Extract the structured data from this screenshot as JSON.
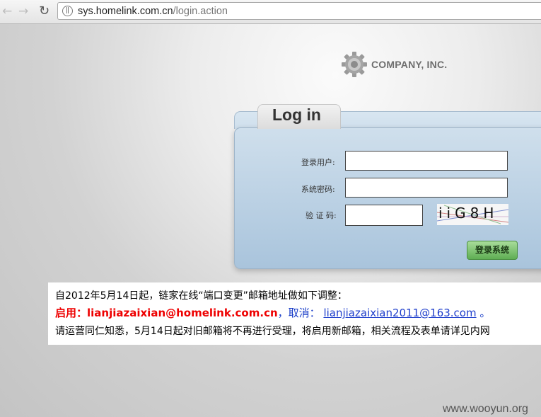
{
  "browser": {
    "url_host": "sys.homelink.com.cn",
    "url_path": "/login.action"
  },
  "logo": {
    "text": "COMPANY, INC."
  },
  "login": {
    "tab_title": "Log in",
    "username_label": "登录用户:",
    "password_label": "系统密码:",
    "captcha_label": "验 证 码:",
    "username_value": "",
    "password_value": "",
    "captcha_value": "",
    "captcha_text": "iiG8H",
    "submit_label": "登录系统"
  },
  "notice": {
    "line1": "自2012年5月14日起，链家在线“端口变更”邮箱地址做如下调整：",
    "enable_prefix": "启用：",
    "enable_email": "lianjiazaixian@homelink.com.cn",
    "cancel_prefix": "，取消：",
    "cancel_email": "lianjiazaixian2011@163.com",
    "end_mark": "。",
    "line3": "请运营同仁知悉，5月14日起对旧邮箱将不再进行受理，将启用新邮箱，相关流程及表单请详见内网"
  },
  "watermark": "www.wooyun.org"
}
